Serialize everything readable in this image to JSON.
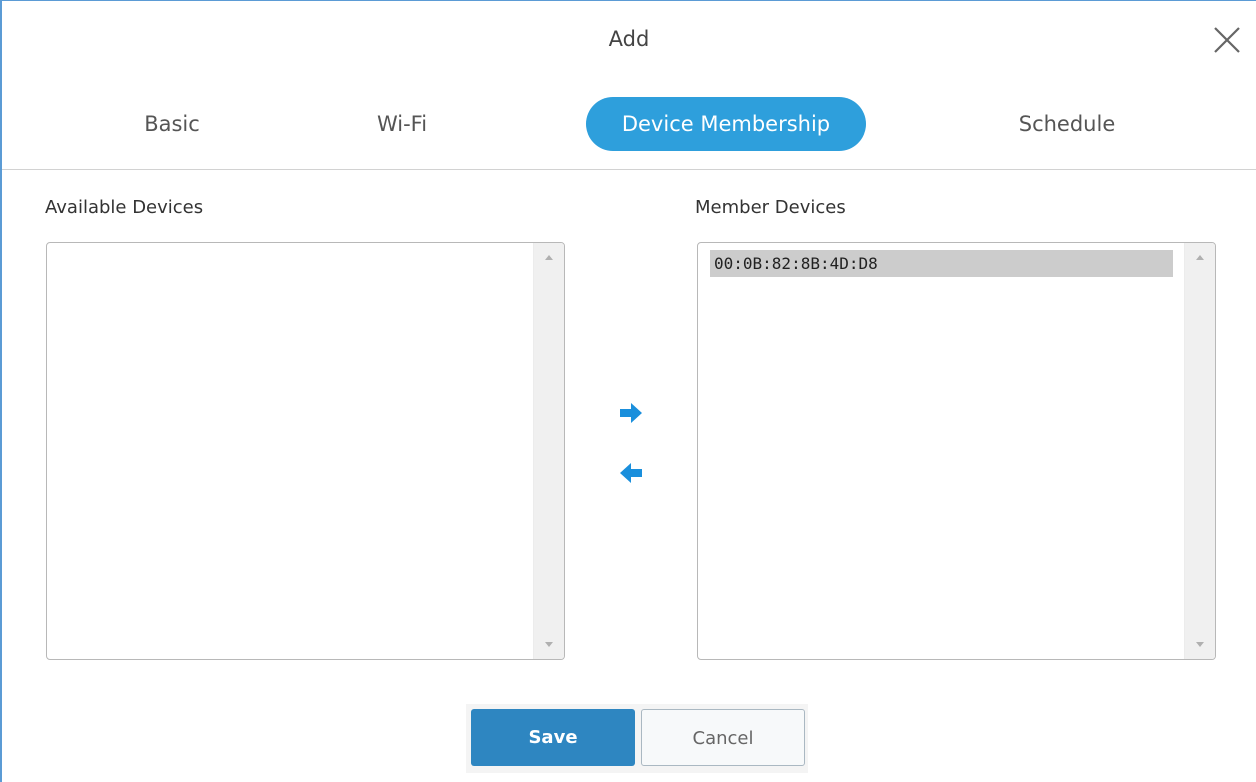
{
  "dialog": {
    "title": "Add"
  },
  "tabs": [
    {
      "label": "Basic",
      "active": false
    },
    {
      "label": "Wi-Fi",
      "active": false
    },
    {
      "label": "Device Membership",
      "active": true
    },
    {
      "label": "Schedule",
      "active": false
    }
  ],
  "available": {
    "label": "Available Devices",
    "items": []
  },
  "member": {
    "label": "Member Devices",
    "items": [
      "00:0B:82:8B:4D:D8"
    ]
  },
  "actions": {
    "save_label": "Save",
    "cancel_label": "Cancel"
  },
  "icons": {
    "close": "close-icon",
    "move_right": "arrow-right-icon",
    "move_left": "arrow-left-icon"
  },
  "colors": {
    "accent": "#2e9fdc",
    "save_button": "#2e86c1",
    "arrow": "#1a8fdc",
    "selected_item": "#cccccc"
  }
}
